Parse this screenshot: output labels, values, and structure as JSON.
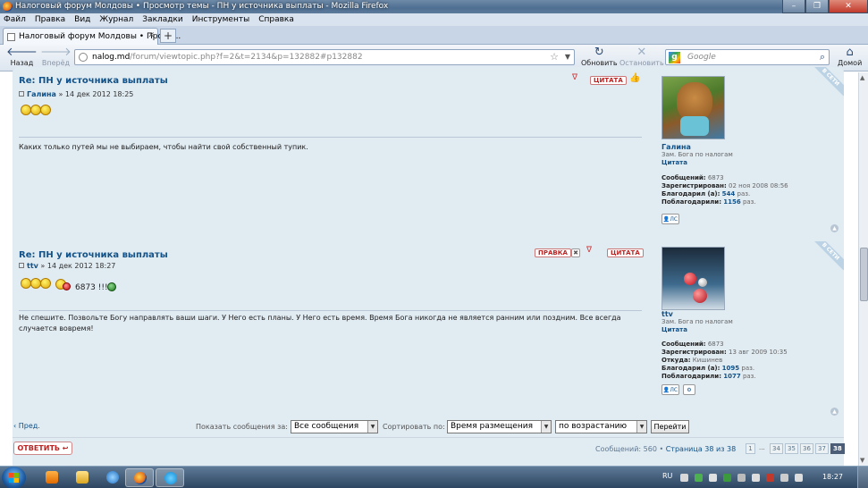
{
  "window": {
    "title": "Налоговый форум Молдовы • Просмотр темы - ПН у источника выплаты - Mozilla Firefox"
  },
  "menu": [
    "Файл",
    "Правка",
    "Вид",
    "Журнал",
    "Закладки",
    "Инструменты",
    "Справка"
  ],
  "tab": {
    "label": "Налоговый форум Молдовы • Просм..."
  },
  "nav": {
    "back": "Назад",
    "forward": "Вперёд",
    "reload": "Обновить",
    "stop": "Остановить",
    "home": "Домой",
    "url_host": "nalog.md",
    "url_path": "/forum/viewtopic.php?f=2&t=2134&p=132882#p132882",
    "search_placeholder": "Google"
  },
  "posts": [
    {
      "title": "Re: ПН у источника выплаты",
      "author": "Галина",
      "date": "» 14 дек 2012 18:25",
      "quote_label": "ЦИТАТА",
      "text": "Каких только путей мы не выбираем, чтобы найти свой собственный тупик.",
      "profile": {
        "name": "Галина",
        "rank": "Зам. Бога по налогам",
        "cit": "Цитата",
        "messages_label": "Сообщений:",
        "messages": "6873",
        "registered_label": "Зарегистрирован:",
        "registered": "02 ноя 2008 08:56",
        "thanked_label": "Благодарил (а):",
        "thanked": "544",
        "thanked_unit": "раз.",
        "thanks_label": "Поблагодарили:",
        "thanks": "1156",
        "thanks_unit": "раз."
      },
      "online": "В СЕТИ"
    },
    {
      "title": "Re: ПН у источника выплаты",
      "author": "ttv",
      "date": "» 14 дек 2012 18:27",
      "edit_label": "ПРАВКА",
      "quote_label": "ЦИТАТА",
      "smiley_text": "6873 !!!",
      "text": "Не спешите. Позвольте Богу направлять ваши шаги. У Него есть планы. У Него есть время. Время Бога никогда не является ранним или поздним. Все всегда случается вовремя!",
      "profile": {
        "name": "ttv",
        "rank": "Зам. Бога по налогам",
        "cit": "Цитата",
        "messages_label": "Сообщений:",
        "messages": "6873",
        "registered_label": "Зарегистрирован:",
        "registered": "13 авг 2009 10:35",
        "from_label": "Откуда:",
        "from": "Кишинев",
        "thanked_label": "Благодарил (а):",
        "thanked": "1095",
        "thanked_unit": "раз.",
        "thanks_label": "Поблагодарили:",
        "thanks": "1077",
        "thanks_unit": "раз."
      },
      "online": "В СЕТИ"
    }
  ],
  "controls": {
    "prev": "‹ Пред.",
    "show_label": "Показать сообщения за:",
    "show_value": "Все сообщения",
    "sort_label": "Сортировать по:",
    "sort_value": "Время размещения",
    "order_value": "по возрастанию",
    "go": "Перейти",
    "reply": "ОТВЕТИТЬ",
    "messages_count": "Сообщений: 560",
    "page_of": "Страница 38 из 38",
    "pages": [
      "1",
      "34",
      "35",
      "36",
      "37",
      "38"
    ],
    "dots": "..."
  },
  "taskbar": {
    "lang": "RU",
    "time": "18:27"
  }
}
